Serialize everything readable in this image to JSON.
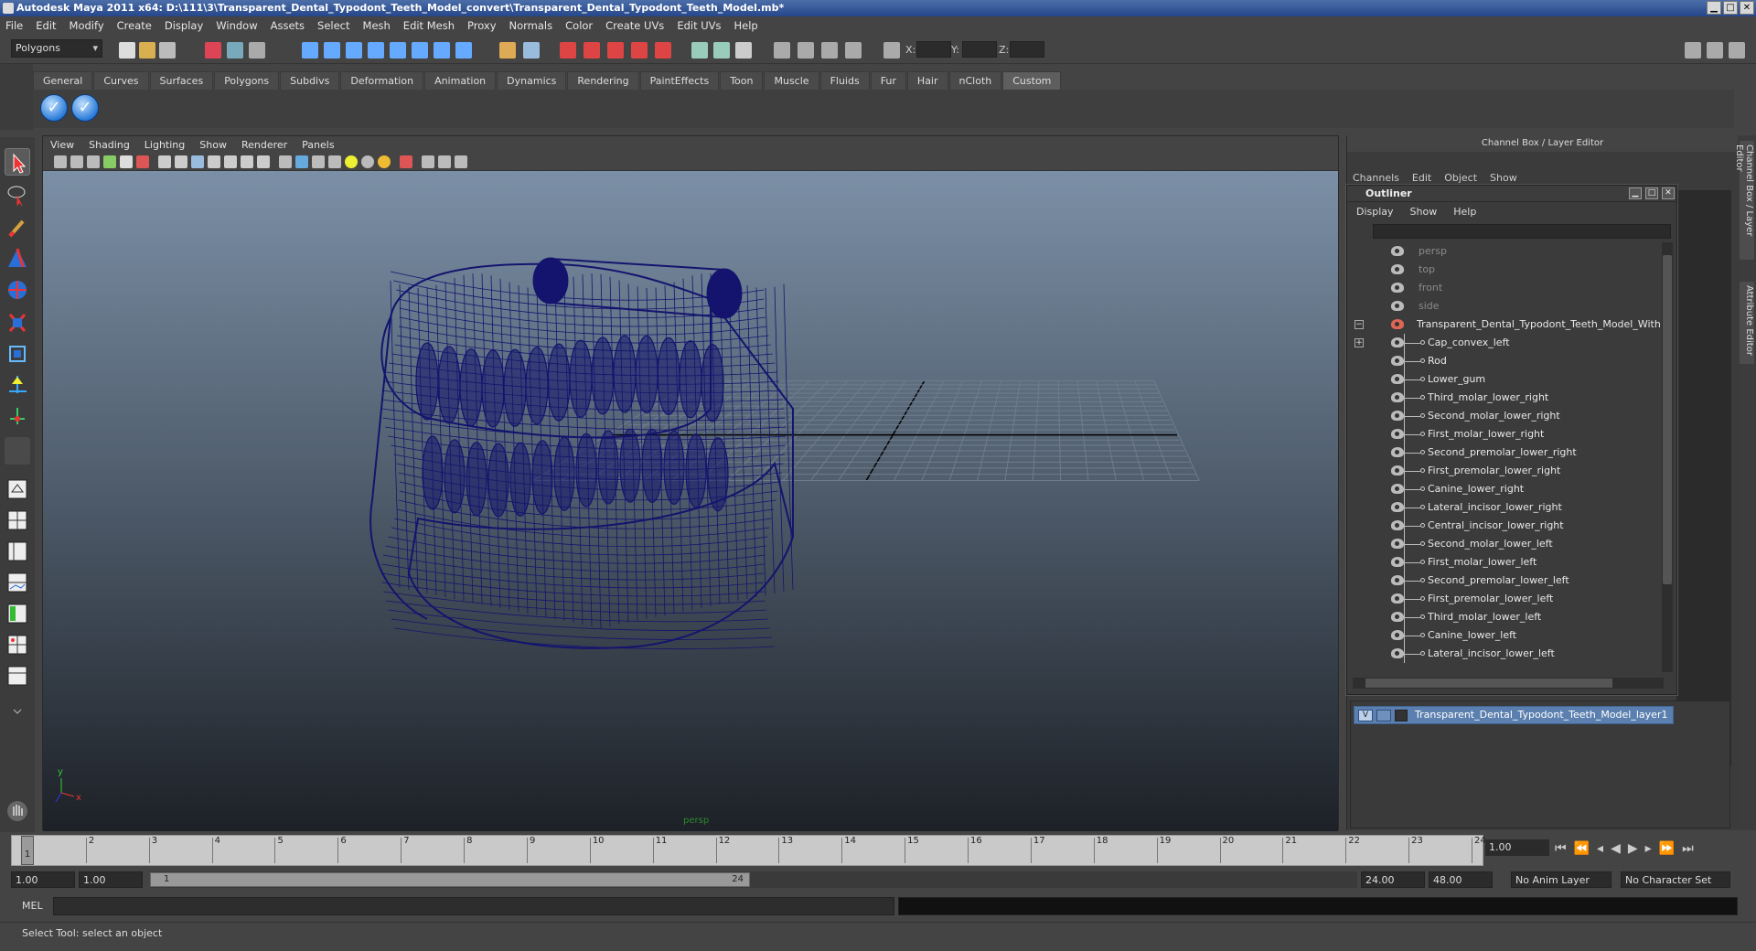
{
  "window": {
    "title": "Autodesk Maya 2011 x64: D:\\111\\3\\Transparent_Dental_Typodont_Teeth_Model_convert\\Transparent_Dental_Typodont_Teeth_Model.mb*",
    "min": "▁",
    "max": "□",
    "close": "✕"
  },
  "menu": [
    "File",
    "Edit",
    "Modify",
    "Create",
    "Display",
    "Window",
    "Assets",
    "Select",
    "Mesh",
    "Edit Mesh",
    "Proxy",
    "Normals",
    "Color",
    "Create UVs",
    "Edit UVs",
    "Help"
  ],
  "status": {
    "mode": "Polygons",
    "x_label": "X:",
    "y_label": "Y:",
    "z_label": "Z:"
  },
  "shelf": {
    "tabs": [
      "General",
      "Curves",
      "Surfaces",
      "Polygons",
      "Subdivs",
      "Deformation",
      "Animation",
      "Dynamics",
      "Rendering",
      "PaintEffects",
      "Toon",
      "Muscle",
      "Fluids",
      "Fur",
      "Hair",
      "nCloth",
      "Custom"
    ],
    "active_tab": "Custom"
  },
  "viewport": {
    "menu": [
      "View",
      "Shading",
      "Lighting",
      "Show",
      "Renderer",
      "Panels"
    ],
    "camera_label": "persp",
    "axis_x": "x",
    "axis_y": "y",
    "colors": {
      "wireframe": "#14146e",
      "grid": "#6f7c8c",
      "axis": "#000000"
    }
  },
  "channel_box": {
    "title": "Channel Box / Layer Editor",
    "menu": [
      "Channels",
      "Edit",
      "Object",
      "Show"
    ]
  },
  "side_tabs": [
    "Channel Box / Layer Editor",
    "Attribute Editor"
  ],
  "outliner": {
    "title": "Outliner",
    "menu": [
      "Display",
      "Show",
      "Help"
    ],
    "cameras": [
      "persp",
      "top",
      "front",
      "side"
    ],
    "group": "Transparent_Dental_Typodont_Teeth_Model_With_Bra",
    "children": [
      "Cap_convex_left",
      "Rod",
      "Lower_gum",
      "Third_molar_lower_right",
      "Second_molar_lower_right",
      "First_molar_lower_right",
      "Second_premolar_lower_right",
      "First_premolar_lower_right",
      "Canine_lower_right",
      "Lateral_incisor_lower_right",
      "Central_incisor_lower_right",
      "Second_molar_lower_left",
      "First_molar_lower_left",
      "Second_premolar_lower_left",
      "First_premolar_lower_left",
      "Third_molar_lower_left",
      "Canine_lower_left",
      "Lateral_incisor_lower_left"
    ]
  },
  "layer": {
    "v": "V",
    "name": "Transparent_Dental_Typodont_Teeth_Model_layer1",
    "color": "#5b7fae"
  },
  "timeline": {
    "ticks": [
      "1",
      "2",
      "3",
      "4",
      "5",
      "6",
      "7",
      "8",
      "9",
      "10",
      "11",
      "12",
      "13",
      "14",
      "15",
      "16",
      "17",
      "18",
      "19",
      "20",
      "21",
      "22",
      "23",
      "24"
    ],
    "current_frame": "1.00",
    "marker": "1"
  },
  "range": {
    "start": "1.00",
    "play_start": "1.00",
    "range_start": "1",
    "range_end": "24",
    "play_end": "24.00",
    "end": "48.00",
    "anim_layer": "No Anim Layer",
    "char_set": "No Character Set"
  },
  "command": {
    "label": "MEL"
  },
  "help": {
    "text": "Select Tool: select an object"
  }
}
